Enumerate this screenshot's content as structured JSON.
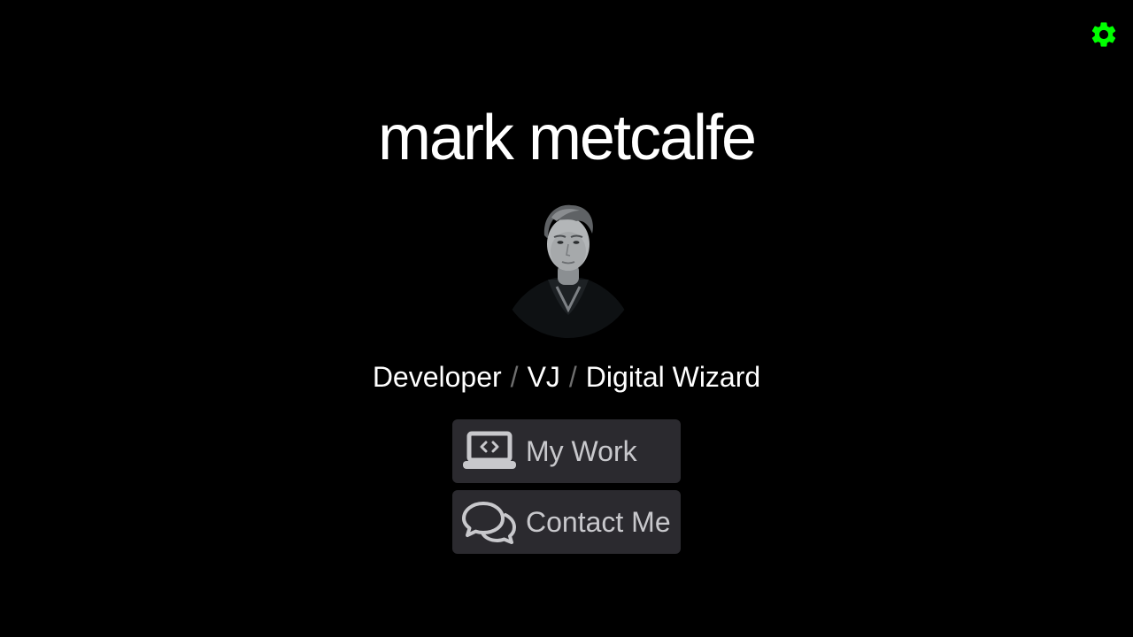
{
  "header": {
    "title": "mark metcalfe"
  },
  "profile": {
    "avatar_alt": "mark metcalfe",
    "roles": [
      "Developer",
      "VJ",
      "Digital Wizard"
    ],
    "separator": "/"
  },
  "actions": {
    "my_work_label": "My Work",
    "contact_label": "Contact Me"
  },
  "icons": {
    "settings": "gear-icon",
    "my_work": "laptop-code-icon",
    "contact": "chat-bubbles-icon"
  },
  "colors": {
    "background": "#000000",
    "accent": "#00ff00",
    "button_bg": "#2b2a2f",
    "button_text": "#c8c8cc",
    "separator": "#6e6e6e"
  }
}
